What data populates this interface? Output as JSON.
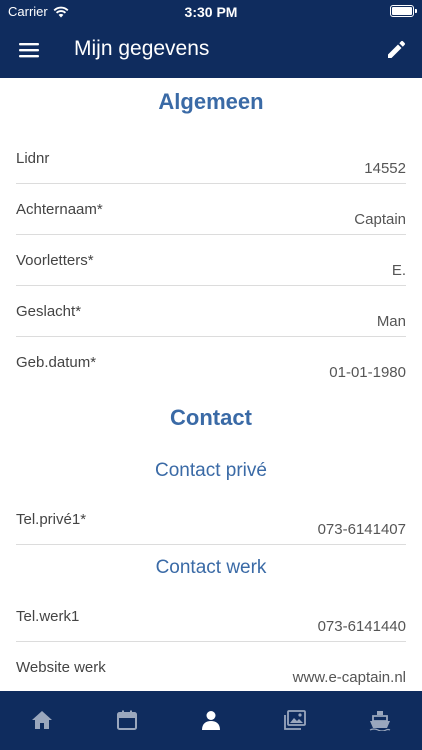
{
  "status_bar": {
    "carrier": "Carrier",
    "time": "3:30 PM"
  },
  "header": {
    "title": "Mijn gegevens"
  },
  "sections": {
    "algemeen": {
      "title": "Algemeen",
      "rows": [
        {
          "label": "Lidnr",
          "value": "14552"
        },
        {
          "label": "Achternaam*",
          "value": "Captain"
        },
        {
          "label": "Voorletters*",
          "value": "E."
        },
        {
          "label": "Geslacht*",
          "value": "Man"
        },
        {
          "label": "Geb.datum*",
          "value": "01-01-1980"
        }
      ]
    },
    "contact": {
      "title": "Contact",
      "prive_title": "Contact privé",
      "prive_rows": [
        {
          "label": "Tel.privé1*",
          "value": "073-6141407"
        }
      ],
      "werk_title": "Contact werk",
      "werk_rows": [
        {
          "label": "Tel.werk1",
          "value": "073-6141440"
        },
        {
          "label": "Website werk",
          "value": "www.e-captain.nl"
        }
      ]
    }
  },
  "tabbar": {
    "tabs": [
      {
        "icon": "home-icon",
        "active": false
      },
      {
        "icon": "calendar-icon",
        "active": false
      },
      {
        "icon": "person-icon",
        "active": true
      },
      {
        "icon": "photos-icon",
        "active": false
      },
      {
        "icon": "boat-icon",
        "active": false
      }
    ],
    "active_color": "#ffffff",
    "inactive_color": "#9aa7bd"
  },
  "colors": {
    "header_bg": "#0f2c5e",
    "accent": "#3a6aa6"
  }
}
